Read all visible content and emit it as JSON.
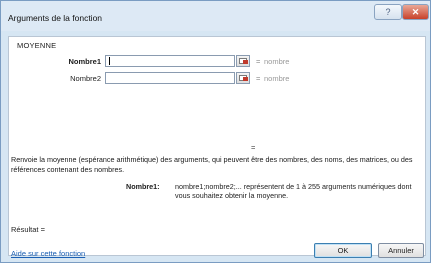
{
  "window": {
    "title": "Arguments de la fonction",
    "help_glyph": "?",
    "close_glyph": "✕"
  },
  "function": {
    "name": "MOYENNE",
    "arguments": [
      {
        "label": "Nombre1",
        "value": "",
        "hint": "nombre",
        "equals": "="
      },
      {
        "label": "Nombre2",
        "value": "",
        "hint": "nombre",
        "equals": "="
      }
    ],
    "result_equals": "=",
    "description": "Renvoie la moyenne (espérance arithmétique) des arguments, qui peuvent être des nombres, des noms, des matrices, ou des références contenant des nombres.",
    "arg_description_label": "Nombre1:",
    "arg_description_text": "nombre1;nombre2;... représentent de 1 à 255 arguments numériques dont vous souhaitez obtenir la moyenne."
  },
  "footer": {
    "result_label": "Résultat =",
    "help_link": "Aide sur cette fonction",
    "ok_label": "OK",
    "cancel_label": "Annuler"
  },
  "colors": {
    "accent": "#1a5fb4",
    "close_button": "#c8412a",
    "dialog_bg": "#d6e6f3"
  }
}
